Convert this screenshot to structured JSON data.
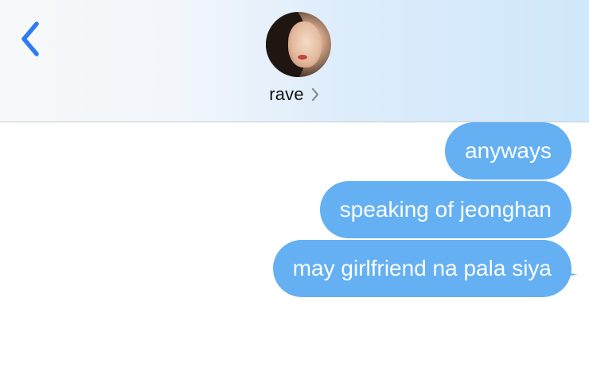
{
  "header": {
    "contact_name": "rave",
    "back_icon": "chevron-left-icon",
    "details_icon": "chevron-right-icon",
    "colors": {
      "accent": "#2f7bf5",
      "header_tint": "#d0e8fb"
    }
  },
  "messages": [
    {
      "text": "anyways",
      "direction": "outgoing"
    },
    {
      "text": "speaking of jeonghan",
      "direction": "outgoing"
    },
    {
      "text": "may girlfriend na pala siya",
      "direction": "outgoing"
    }
  ],
  "colors": {
    "outgoing_bubble": "#64b0f3",
    "bubble_text": "#ffffff"
  }
}
